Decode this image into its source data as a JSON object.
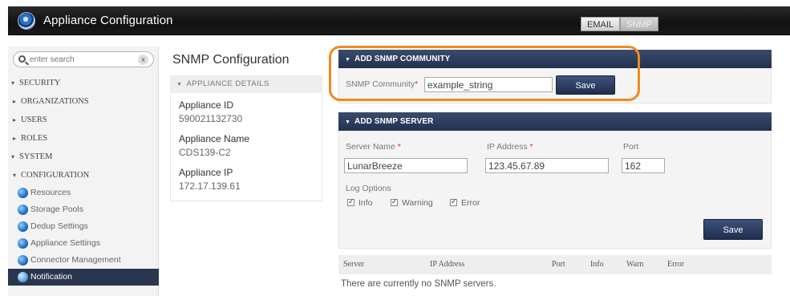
{
  "app": {
    "title": "Appliance Configuration",
    "tabs": [
      {
        "label": "EMAIL",
        "active": false
      },
      {
        "label": "SNMP",
        "active": true
      }
    ]
  },
  "sidebar": {
    "search_placeholder": "enter search",
    "clear_label": "x",
    "items": [
      {
        "label": "SECURITY",
        "arrow": "▾",
        "level": 0
      },
      {
        "label": "ORGANIZATIONS",
        "arrow": "▸",
        "level": 1
      },
      {
        "label": "USERS",
        "arrow": "▸",
        "level": 1
      },
      {
        "label": "ROLES",
        "arrow": "▸",
        "level": 1
      },
      {
        "label": "SYSTEM",
        "arrow": "▾",
        "level": 0
      },
      {
        "label": "CONFIGURATION",
        "arrow": "▾",
        "level": 1
      }
    ],
    "sub_items": [
      {
        "label": "Resources",
        "icon": "globe-icon"
      },
      {
        "label": "Storage Pools",
        "icon": "globe-icon"
      },
      {
        "label": "Dedup Settings",
        "icon": "globe-icon"
      },
      {
        "label": "Appliance Settings",
        "icon": "globe-icon"
      },
      {
        "label": "Connector Management",
        "icon": "globe-icon"
      },
      {
        "label": "Notification",
        "icon": "globe-icon",
        "active": true
      }
    ]
  },
  "details": {
    "title": "SNMP Configuration",
    "section_header": "APPLIANCE DETAILS",
    "appliance_id_label": "Appliance ID",
    "appliance_id": "590021132730",
    "appliance_name_label": "Appliance Name",
    "appliance_name": "CDS139-C2",
    "appliance_ip_label": "Appliance IP",
    "appliance_ip": "172.17.139.61"
  },
  "community": {
    "header": "ADD SNMP COMMUNITY",
    "label": "SNMP Community",
    "required_mark": "*",
    "value": "example_string",
    "save_label": "Save"
  },
  "server": {
    "header": "ADD SNMP SERVER",
    "server_name_label": "Server Name",
    "server_name": "LunarBreeze",
    "ip_label": "IP Address",
    "ip_value": "123.45.67.89",
    "port_label": "Port",
    "port_value": "162",
    "required_mark": "*",
    "log_options_label": "Log Options",
    "log_info": "Info",
    "log_warning": "Warning",
    "log_error": "Error",
    "save_label": "Save"
  },
  "servers_table": {
    "columns": [
      "Server",
      "IP Address",
      "Port",
      "Info",
      "Warn",
      "Error"
    ],
    "empty_message": "There are currently no SNMP servers."
  },
  "colors": {
    "header_bar": "#223150",
    "highlight": "#f08a1e",
    "active_nav": "#2a3550"
  }
}
